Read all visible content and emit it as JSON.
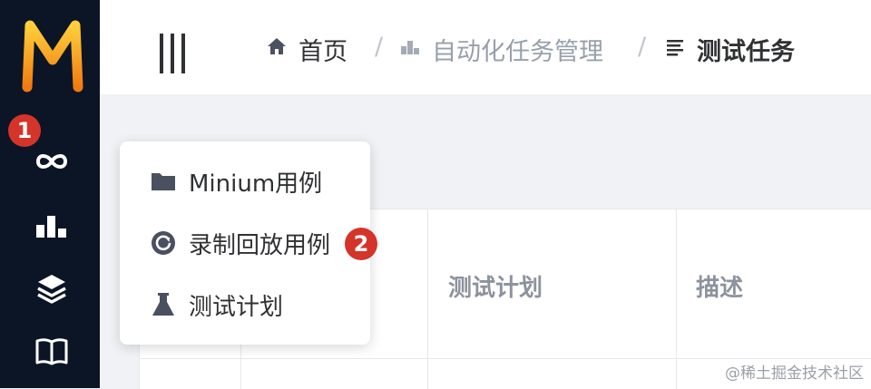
{
  "header": {
    "breadcrumb": [
      {
        "label": "首页"
      },
      {
        "label": "自动化任务管理"
      },
      {
        "label": "测试任务"
      }
    ],
    "separator": "/"
  },
  "dropdown_menu": {
    "items": [
      {
        "label": "Minium用例",
        "icon": "folder-icon"
      },
      {
        "label": "录制回放用例",
        "icon": "replay-icon"
      },
      {
        "label": "测试计划",
        "icon": "flask-icon"
      }
    ]
  },
  "table": {
    "headers": [
      "测试计划",
      "描述"
    ]
  },
  "annotations": {
    "badge_1": "1",
    "badge_2": "2"
  },
  "watermark": "@稀土掘金技术社区",
  "colors": {
    "sidebar_bg": "#0c1526",
    "badge": "#d4342a",
    "logo_orange": "#f5a623"
  }
}
